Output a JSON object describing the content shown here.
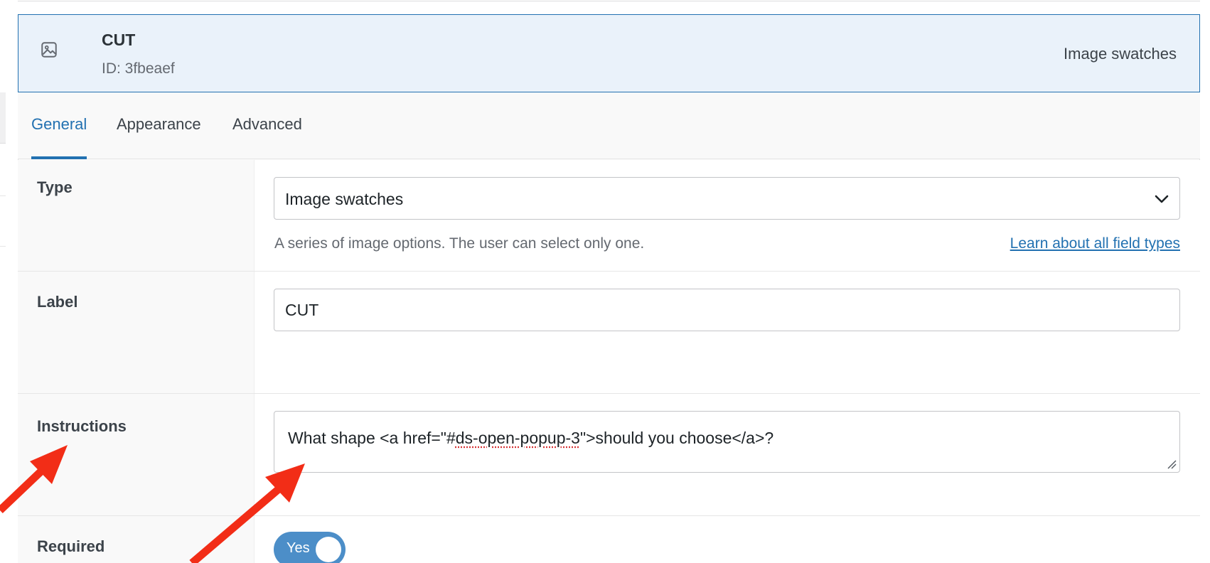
{
  "field": {
    "title": "CUT",
    "id_text": "ID: 3fbeaef",
    "type_display": "Image swatches",
    "icon": "image-icon"
  },
  "tabs": [
    {
      "label": "General",
      "active": true
    },
    {
      "label": "Appearance",
      "active": false
    },
    {
      "label": "Advanced",
      "active": false
    }
  ],
  "type_row": {
    "label": "Type",
    "selected": "Image swatches",
    "help": "A series of image options. The user can select only one.",
    "link": "Learn about all field types"
  },
  "label_row": {
    "label": "Label",
    "value": "CUT"
  },
  "instructions_row": {
    "label": "Instructions",
    "value_before": "What shape <a href=\"#",
    "value_spell": "ds-open-popup-3",
    "value_after": "\">should you choose</a>?"
  },
  "required_row": {
    "label": "Required",
    "toggle_label": "Yes",
    "on": true
  },
  "colors": {
    "accent": "#2271b1",
    "toggle": "#4c8ec8",
    "arrow": "#f22d17",
    "header_bg": "#eaf2fa"
  }
}
